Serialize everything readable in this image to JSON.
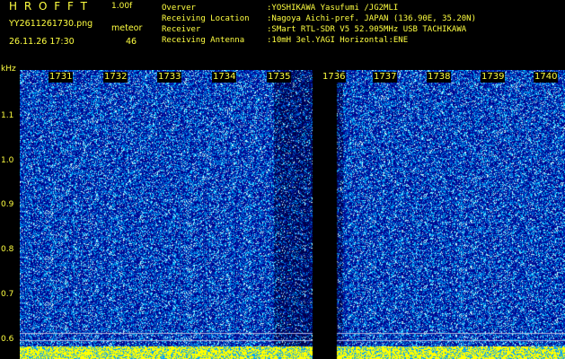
{
  "header": {
    "app_title": "H R O F F T",
    "version": "1.00f",
    "filename": "YY2611261730.png",
    "datetime": "26.11.26 17:30",
    "meteor_label": "meteor",
    "meteor_count": "46"
  },
  "info": [
    {
      "label": "Overver",
      "value": ":YOSHIKAWA Yasufumi /JG2MLI"
    },
    {
      "label": "Receiving Location",
      "value": ":Nagoya Aichi-pref. JAPAN (136.90E, 35.20N)"
    },
    {
      "label": "Receiver",
      "value": ":SMart RTL-SDR V5 52.905MHz USB TACHIKAWA"
    },
    {
      "label": "Receiving Antenna",
      "value": ":10mH 3el.YAGI Horizontal:ENE"
    }
  ],
  "axis": {
    "unit": "kHz",
    "y_ticks": [
      "1.1",
      "1.0",
      "0.9",
      "0.8",
      "0.7",
      "0.6"
    ],
    "time_labels": [
      "1731",
      "1732",
      "1733",
      "1734",
      "1735",
      "1736",
      "1737",
      "1738",
      "1739",
      "1740"
    ]
  },
  "colors": {
    "text": "#ffff40",
    "background": "#000000",
    "waterfall_base": "#00008a",
    "waterfall_noise": "#00c8ff",
    "signal_band": "#ffff00"
  }
}
